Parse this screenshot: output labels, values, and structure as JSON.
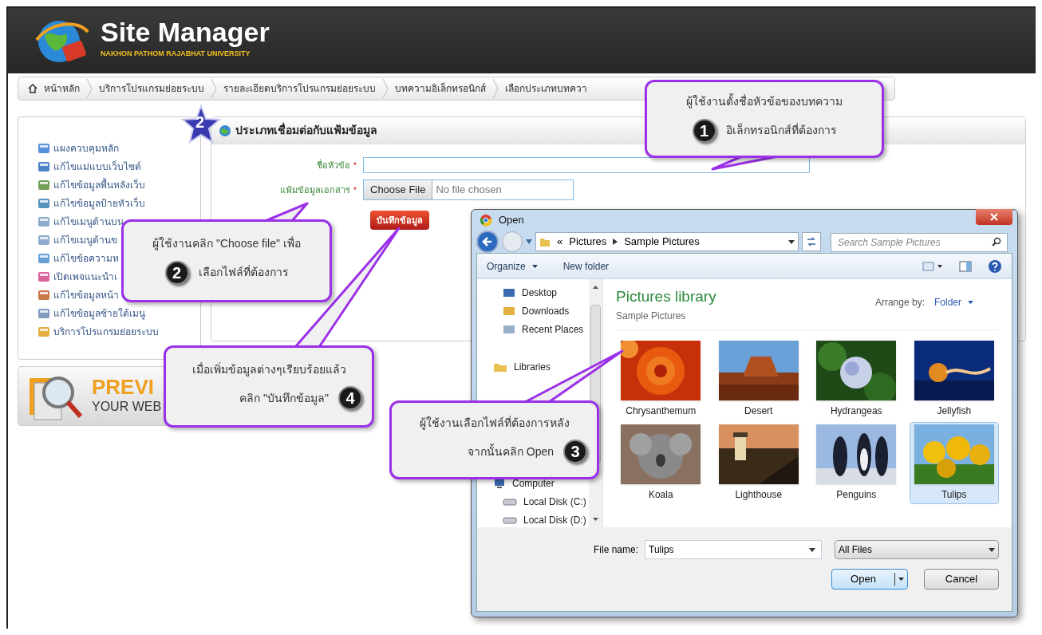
{
  "header": {
    "title": "Site Manager",
    "subtitle": "NAKHON PATHOM RAJABHAT UNIVERSITY"
  },
  "breadcrumb": [
    "หน้าหลัก",
    "บริการโปรแกรมย่อยระบบ",
    "รายละเอียดบริการโปรแกรมย่อยระบบ",
    "บทความอิเล็กทรอนิกส์",
    "เลือกประเภทบทควา"
  ],
  "sidebar": {
    "items": [
      "แผงควบคุมหลัก",
      "แก้ไขแม่แบบเว็บไซต์",
      "แก้ไขข้อมูลพื้นหลังเว็บ",
      "แก้ไขข้อมูลป้ายหัวเว็บ",
      "แก้ไขเมนูด้านบน",
      "แก้ไขเมนูด้านข",
      "แก้ไขข้อความห",
      "เปิดเพจแนะนำเ",
      "แก้ไขข้อมูลหน้า",
      "แก้ไขข้อมูลซ้ายใต้เมนู",
      "บริการโปรแกรมย่อยระบบ"
    ]
  },
  "banner": {
    "title": "PREVI",
    "subtitle": "YOUR WEB"
  },
  "panel": {
    "step": "2",
    "title": "ประเภทเชื่อมต่อกับแฟ้มข้อมูล",
    "fields": [
      {
        "kind": "text",
        "label": "ชื่อหัวข้อ",
        "mark": "*"
      },
      {
        "kind": "file",
        "label": "แฟ้มข้อมูลเอกสาร",
        "mark": "*",
        "button": "Choose File",
        "value": "No file chosen"
      }
    ],
    "submit": "บันทึกข้อมูล"
  },
  "dialog": {
    "title": "Open",
    "path_prefix": "«",
    "path": [
      "Pictures",
      "Sample Pictures"
    ],
    "search_placeholder": "Search Sample Pictures",
    "toolbar": [
      "Organize",
      "New folder"
    ],
    "favorites": [
      "Desktop",
      "Downloads",
      "Recent Places"
    ],
    "libraries": "Libraries",
    "computer": {
      "label": "Computer",
      "drives": [
        "Local Disk (C:)",
        "Local Disk (D:)"
      ]
    },
    "library_title": "Pictures library",
    "library_subtitle": "Sample Pictures",
    "arrange_label": "Arrange by:",
    "arrange_value": "Folder",
    "files": [
      {
        "name": "Chrysanthemum",
        "selected": false
      },
      {
        "name": "Desert",
        "selected": false
      },
      {
        "name": "Hydrangeas",
        "selected": false
      },
      {
        "name": "Jellyfish",
        "selected": false
      },
      {
        "name": "Koala",
        "selected": false
      },
      {
        "name": "Lighthouse",
        "selected": false
      },
      {
        "name": "Penguins",
        "selected": false
      },
      {
        "name": "Tulips",
        "selected": true
      }
    ],
    "file_name_label": "File name:",
    "file_name": "Tulips",
    "filter": "All Files",
    "buttons": [
      "Open",
      "Cancel"
    ]
  },
  "callouts": [
    {
      "number": "1",
      "lines": [
        "ผู้ใช้งานตั้งชื่อหัวข้อของบทความ",
        "อิเล็กทรอนิกส์ที่ต้องการ"
      ]
    },
    {
      "number": "2",
      "lines": [
        "ผู้ใช้งานคลิก \"Choose file\" เพื่อ",
        "เลือกไฟล์ที่ต้องการ"
      ]
    },
    {
      "number": "4",
      "lines": [
        "เมื่อเพิ่มข้อมูลต่างๆเรียบร้อยแล้ว",
        "คลิก \"บันทึกข้อมูล\""
      ]
    },
    {
      "number": "3",
      "lines": [
        "ผู้ใช้งานเลือกไฟล์ที่ต้องการหลัง",
        "จากนั้นคลิก Open"
      ]
    }
  ]
}
